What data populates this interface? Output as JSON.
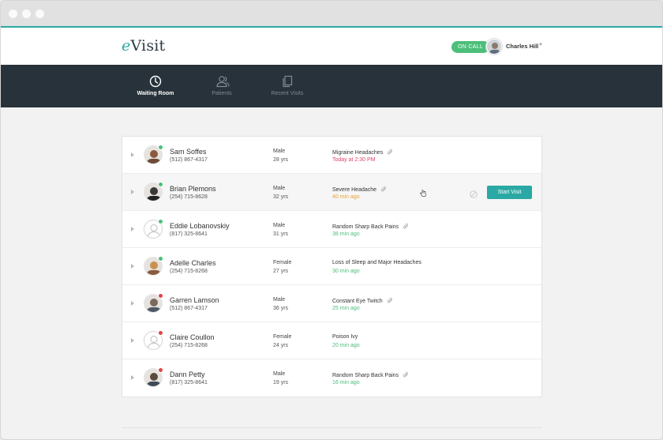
{
  "app": {
    "logo_prefix": "e",
    "logo_rest": "Visit",
    "on_call_label": "ON CALL",
    "user_name": "Charles Hill"
  },
  "nav": [
    {
      "label": "Waiting Room",
      "icon": "clock-icon",
      "active": true
    },
    {
      "label": "Patients",
      "icon": "patients-icon",
      "active": false
    },
    {
      "label": "Recent Visits",
      "icon": "documents-icon",
      "active": false
    }
  ],
  "patients": [
    {
      "name": "Sam Soffes",
      "phone": "(512) 867-4317",
      "gender": "Male",
      "age": "28 yrs",
      "complaint": "Migraine Headaches",
      "attachment": true,
      "wait": "Today at 2:30 PM",
      "wait_color": "#e0446a",
      "status_color": "#4cbf7a",
      "avatar": "photo"
    },
    {
      "name": "Brian Plemons",
      "phone": "(254) 715-8628",
      "gender": "Male",
      "age": "32 yrs",
      "complaint": "Severe Headache",
      "attachment": true,
      "wait": "40 min ago",
      "wait_color": "#e8a23a",
      "status_color": "#4cbf7a",
      "avatar": "photo"
    },
    {
      "name": "Eddie Lobanovskiy",
      "phone": "(817) 325-8641",
      "gender": "Male",
      "age": "31 yrs",
      "complaint": "Random Sharp Back Pains",
      "attachment": true,
      "wait": "38 min ago",
      "wait_color": "#4cbf7a",
      "status_color": "#4cbf7a",
      "avatar": "blank"
    },
    {
      "name": "Adelle Charles",
      "phone": "(254) 715-8268",
      "gender": "Female",
      "age": "27 yrs",
      "complaint": "Loss of Sleep and Major Headaches",
      "attachment": false,
      "wait": "30 min ago",
      "wait_color": "#4cbf7a",
      "status_color": "#4cbf7a",
      "avatar": "photo"
    },
    {
      "name": "Garren Lamson",
      "phone": "(512) 867-4317",
      "gender": "Male",
      "age": "36 yrs",
      "complaint": "Constant Eye Twitch",
      "attachment": true,
      "wait": "25 min ago",
      "wait_color": "#4cbf7a",
      "status_color": "#e0444a",
      "avatar": "photo"
    },
    {
      "name": "Claire Coullon",
      "phone": "(254) 715-8268",
      "gender": "Female",
      "age": "24 yrs",
      "complaint": "Poison Ivy",
      "attachment": false,
      "wait": "20 min ago",
      "wait_color": "#4cbf7a",
      "status_color": "#e0444a",
      "avatar": "blank"
    },
    {
      "name": "Dann Petty",
      "phone": "(817) 325-8641",
      "gender": "Male",
      "age": "19 yrs",
      "complaint": "Random Sharp Back Pains",
      "attachment": true,
      "wait": "16 min ago",
      "wait_color": "#4cbf7a",
      "status_color": "#e0444a",
      "avatar": "photo"
    }
  ],
  "row_action": {
    "label": "Start Visit"
  },
  "colors": {
    "accent": "#2aa9a4",
    "navbar": "#27323a",
    "online": "#4cbf7a",
    "offline": "#e0444a"
  }
}
